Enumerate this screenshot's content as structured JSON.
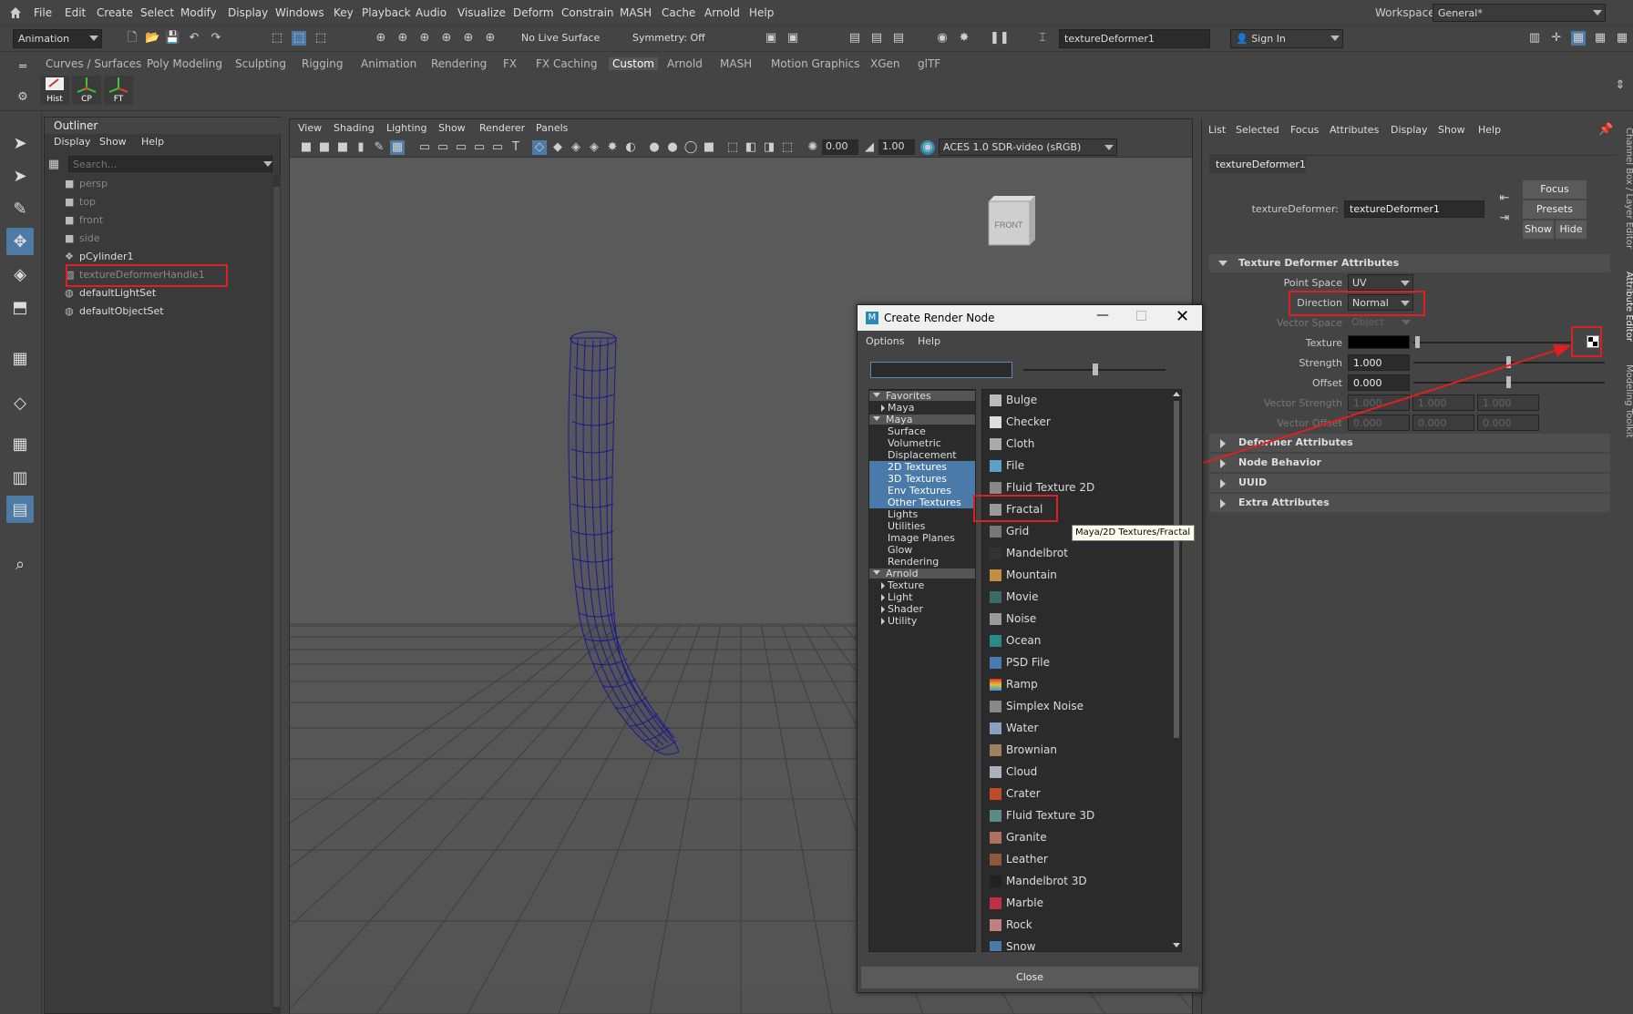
{
  "menubar": {
    "items": [
      "File",
      "Edit",
      "Create",
      "Select",
      "Modify",
      "Display",
      "Windows",
      "Key",
      "Playback",
      "Audio",
      "Visualize",
      "Deform",
      "Constrain",
      "MASH",
      "Cache",
      "Arnold",
      "Help"
    ],
    "workspace_label": "Workspace:",
    "workspace_value": "General*"
  },
  "statusline": {
    "mode": "Animation",
    "live_surface": "No Live Surface",
    "symmetry": "Symmetry: Off",
    "name_field": "textureDeformer1",
    "sign_in": "Sign In"
  },
  "shelf": {
    "tabs": [
      "Curves / Surfaces",
      "Poly Modeling",
      "Sculpting",
      "Rigging",
      "Animation",
      "Rendering",
      "FX",
      "FX Caching",
      "Custom",
      "Arnold",
      "MASH",
      "Motion Graphics",
      "XGen",
      "glTF"
    ],
    "active_tab": "Custom",
    "buttons": [
      "Hist",
      "CP",
      "FT"
    ]
  },
  "outliner": {
    "title": "Outliner",
    "menu": [
      "Display",
      "Show",
      "Help"
    ],
    "search_placeholder": "Search...",
    "items": [
      {
        "label": "persp",
        "icon": "camera-icon",
        "dim": true
      },
      {
        "label": "top",
        "icon": "camera-icon",
        "dim": true
      },
      {
        "label": "front",
        "icon": "camera-icon",
        "dim": true
      },
      {
        "label": "side",
        "icon": "camera-icon",
        "dim": true
      },
      {
        "label": "pCylinder1",
        "icon": "mesh-transform-icon",
        "dim": false
      },
      {
        "label": "textureDeformerHandle1",
        "icon": "deformer-handle-icon",
        "dim": true
      },
      {
        "label": "defaultLightSet",
        "icon": "set-icon",
        "dim": false
      },
      {
        "label": "defaultObjectSet",
        "icon": "set-icon",
        "dim": false
      }
    ]
  },
  "viewport": {
    "menu": [
      "View",
      "Shading",
      "Lighting",
      "Show",
      "Renderer",
      "Panels"
    ],
    "exposure": "0.00",
    "gamma": "1.00",
    "color_space": "ACES 1.0 SDR-video (sRGB)",
    "viewcube_label": "FRONT"
  },
  "dialog": {
    "title": "Create Render Node",
    "menu": [
      "Options",
      "Help"
    ],
    "categories": [
      {
        "label": "Favorites",
        "type": "head"
      },
      {
        "label": "Maya",
        "type": "child-collapsed"
      },
      {
        "label": "Maya",
        "type": "head"
      },
      {
        "label": "Surface",
        "type": "item"
      },
      {
        "label": "Volumetric",
        "type": "item"
      },
      {
        "label": "Displacement",
        "type": "item"
      },
      {
        "label": "2D Textures",
        "type": "sel"
      },
      {
        "label": "3D Textures",
        "type": "sel"
      },
      {
        "label": "Env Textures",
        "type": "sel"
      },
      {
        "label": "Other Textures",
        "type": "sel"
      },
      {
        "label": "Lights",
        "type": "item"
      },
      {
        "label": "Utilities",
        "type": "item"
      },
      {
        "label": "Image Planes",
        "type": "item"
      },
      {
        "label": "Glow",
        "type": "item"
      },
      {
        "label": "Rendering",
        "type": "item"
      },
      {
        "label": "Arnold",
        "type": "head"
      },
      {
        "label": "Texture",
        "type": "child-collapsed"
      },
      {
        "label": "Light",
        "type": "child-collapsed"
      },
      {
        "label": "Shader",
        "type": "child-collapsed"
      },
      {
        "label": "Utility",
        "type": "child-collapsed"
      }
    ],
    "nodes": [
      {
        "label": "Bulge",
        "color": "#bbbbbb"
      },
      {
        "label": "Checker",
        "color": "#dddddd"
      },
      {
        "label": "Cloth",
        "color": "#aaaaaa"
      },
      {
        "label": "File",
        "color": "#5aa0c8"
      },
      {
        "label": "Fluid Texture 2D",
        "color": "#888888"
      },
      {
        "label": "Fractal",
        "color": "#999999"
      },
      {
        "label": "Grid",
        "color": "#777777"
      },
      {
        "label": "Mandelbrot",
        "color": "#333333"
      },
      {
        "label": "Mountain",
        "color": "#c09040"
      },
      {
        "label": "Movie",
        "color": "#3a6a6a"
      },
      {
        "label": "Noise",
        "color": "#999999"
      },
      {
        "label": "Ocean",
        "color": "#2a8a8a"
      },
      {
        "label": "PSD File",
        "color": "#4a7ab0"
      },
      {
        "label": "Ramp",
        "color": "#e07030"
      },
      {
        "label": "Simplex Noise",
        "color": "#888888"
      },
      {
        "label": "Water",
        "color": "#8aa0c0"
      },
      {
        "label": "Brownian",
        "color": "#a08060"
      },
      {
        "label": "Cloud",
        "color": "#aab0c0"
      },
      {
        "label": "Crater",
        "color": "#c04a2a"
      },
      {
        "label": "Fluid Texture 3D",
        "color": "#5a8a8a"
      },
      {
        "label": "Granite",
        "color": "#b07060"
      },
      {
        "label": "Leather",
        "color": "#8a5a3a"
      },
      {
        "label": "Mandelbrot 3D",
        "color": "#222222"
      },
      {
        "label": "Marble",
        "color": "#c03040"
      },
      {
        "label": "Rock",
        "color": "#c08080"
      },
      {
        "label": "Snow",
        "color": "#4a7aaa"
      }
    ],
    "tooltip": "Maya/2D Textures/Fractal",
    "close_button": "Close"
  },
  "attribute_editor": {
    "menu": [
      "List",
      "Selected",
      "Focus",
      "Attributes",
      "Display",
      "Show",
      "Help"
    ],
    "node_tab": "textureDeformer1",
    "node_type_label": "textureDeformer:",
    "node_name": "textureDeformer1",
    "focus_btn": "Focus",
    "presets_btn": "Presets",
    "show_btn": "Show",
    "hide_btn": "Hide",
    "section_main": "Texture Deformer Attributes",
    "point_space_label": "Point Space",
    "point_space_value": "UV",
    "direction_label": "Direction",
    "direction_value": "Normal",
    "vector_space_label": "Vector Space",
    "vector_space_value": "Object",
    "texture_label": "Texture",
    "strength_label": "Strength",
    "strength_value": "1.000",
    "offset_label": "Offset",
    "offset_value": "0.000",
    "vector_strength_label": "Vector Strength",
    "vector_strength_values": [
      "1.000",
      "1.000",
      "1.000"
    ],
    "vector_offset_label": "Vector Offset",
    "vector_offset_values": [
      "0.000",
      "0.000",
      "0.000"
    ],
    "sections_collapsed": [
      "Deformer Attributes",
      "Node Behavior",
      "UUID",
      "Extra Attributes"
    ],
    "side_tabs": [
      "Channel Box / Layer Editor",
      "Attribute Editor",
      "Modeling Toolkit"
    ]
  },
  "colors": {
    "highlight_red": "#e02020",
    "selection_blue": "#4a7aaa",
    "wireframe": "#1a1a8c"
  }
}
